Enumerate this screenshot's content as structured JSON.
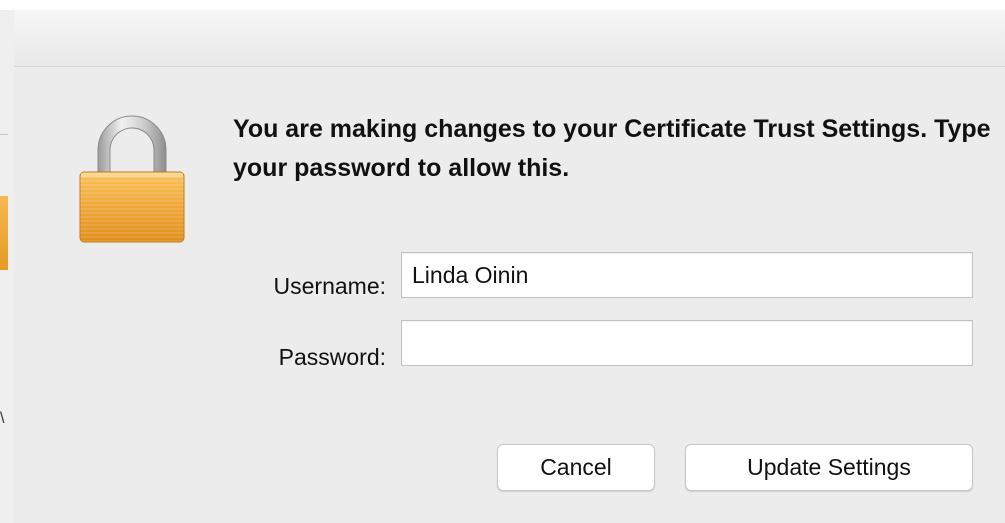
{
  "background_window": {
    "fragment_glyph": "\\"
  },
  "dialog": {
    "message": "You are making changes to your Certificate Trust Settings. Type your password to allow this.",
    "username_label": "Username:",
    "username_value": "Linda Oinin",
    "password_label": "Password:",
    "password_value": "",
    "cancel_label": "Cancel",
    "update_label": "Update Settings",
    "lock_icon": "lock-icon"
  },
  "colors": {
    "dialog_background": "#ececec",
    "lock_body": "#f0a73a",
    "lock_shackle": "#b8b8b8"
  }
}
